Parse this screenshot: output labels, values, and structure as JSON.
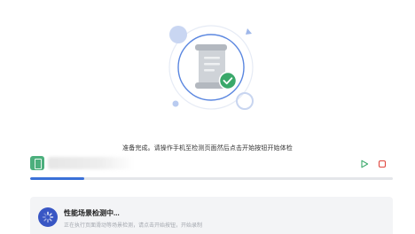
{
  "status": {
    "message": "准备完成。请操作手机至检测页面然后点击开始按钮开始体检"
  },
  "device": {
    "icon": "phone-icon"
  },
  "controls": {
    "play_icon": "play-icon",
    "stop_icon": "stop-icon",
    "play_color": "#3aa86a",
    "stop_color": "#e0473f"
  },
  "progress": {
    "value": 0.15,
    "color": "#3a70d8"
  },
  "task": {
    "icon": "loading-spinner-icon",
    "title": "性能场景检测中...",
    "subtitle": "正在执行页面滑动等场景检测，请点击开始按钮，开始录制"
  },
  "illustration": {
    "icon": "document-scroll-check-icon",
    "accent_color": "#3aa86a"
  }
}
